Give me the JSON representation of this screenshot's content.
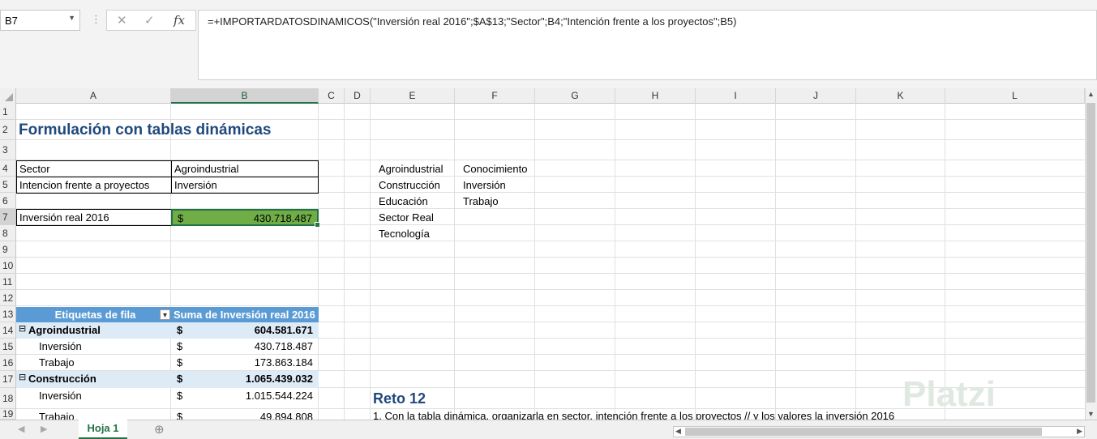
{
  "name_box": {
    "value": "B7",
    "dropdown_glyph": "▼"
  },
  "formula_bar": {
    "cancel_glyph": "✕",
    "enter_glyph": "✓",
    "fx_glyph": "fx",
    "formula": "=+IMPORTARDATOSDINAMICOS(\"Inversión real 2016\";$A$13;\"Sector\";B4;\"Intención frente a los proyectos\";B5)"
  },
  "columns": [
    "A",
    "B",
    "C",
    "D",
    "E",
    "F",
    "G",
    "H",
    "I",
    "J",
    "K",
    "L"
  ],
  "rows": [
    "1",
    "2",
    "3",
    "4",
    "5",
    "6",
    "7",
    "8",
    "9",
    "10",
    "11",
    "12",
    "13",
    "14",
    "15",
    "16",
    "17",
    "18",
    "19"
  ],
  "selected_cell": {
    "column": "B",
    "row": "7"
  },
  "cells": {
    "A2": "Formulación con tablas dinámicas",
    "A4": "Sector",
    "B4": "Agroindustrial",
    "A5": "Intencion frente a proyectos",
    "B5": "Inversión",
    "A7": "Inversión real 2016",
    "B7_currency": "$",
    "B7_value": "430.718.487",
    "E4": "Agroindustrial",
    "F4": "Conocimiento",
    "E5": "Construcción",
    "F5": "Inversión",
    "E6": "Educación",
    "F6": "Trabajo",
    "E7": "Sector Real",
    "E8": "Tecnología",
    "E18": "Reto 12",
    "E19": "1. Con la tabla dinámica, organizarla en sector, intención frente a los proyectos // y los valores la inversión 2016"
  },
  "pivot": {
    "header_rows": "Etiquetas de fila",
    "header_values": "Suma de Inversión real 2016",
    "filter_glyph": "▾",
    "collapse_glyph": "⊟",
    "rows": [
      {
        "label": "Agroindustrial",
        "currency": "$",
        "value": "604.581.671",
        "level": 0
      },
      {
        "label": "Inversión",
        "currency": "$",
        "value": "430.718.487",
        "level": 1
      },
      {
        "label": "Trabajo",
        "currency": "$",
        "value": "173.863.184",
        "level": 1
      },
      {
        "label": "Construcción",
        "currency": "$",
        "value": "1.065.439.032",
        "level": 0
      },
      {
        "label": "Inversión",
        "currency": "$",
        "value": "1.015.544.224",
        "level": 1
      },
      {
        "label": "Trabajo",
        "currency": "$",
        "value": "49.894.808",
        "level": 1
      }
    ]
  },
  "sheet_tabs": {
    "active": "Hoja 1",
    "add_glyph": "⊕"
  },
  "watermark": "Platzi",
  "colors": {
    "pivot_header": "#5b9bd5",
    "pivot_band": "#ddebf7",
    "selected_fill": "#70ad47",
    "title": "#1f497d",
    "excel_green": "#217346"
  }
}
